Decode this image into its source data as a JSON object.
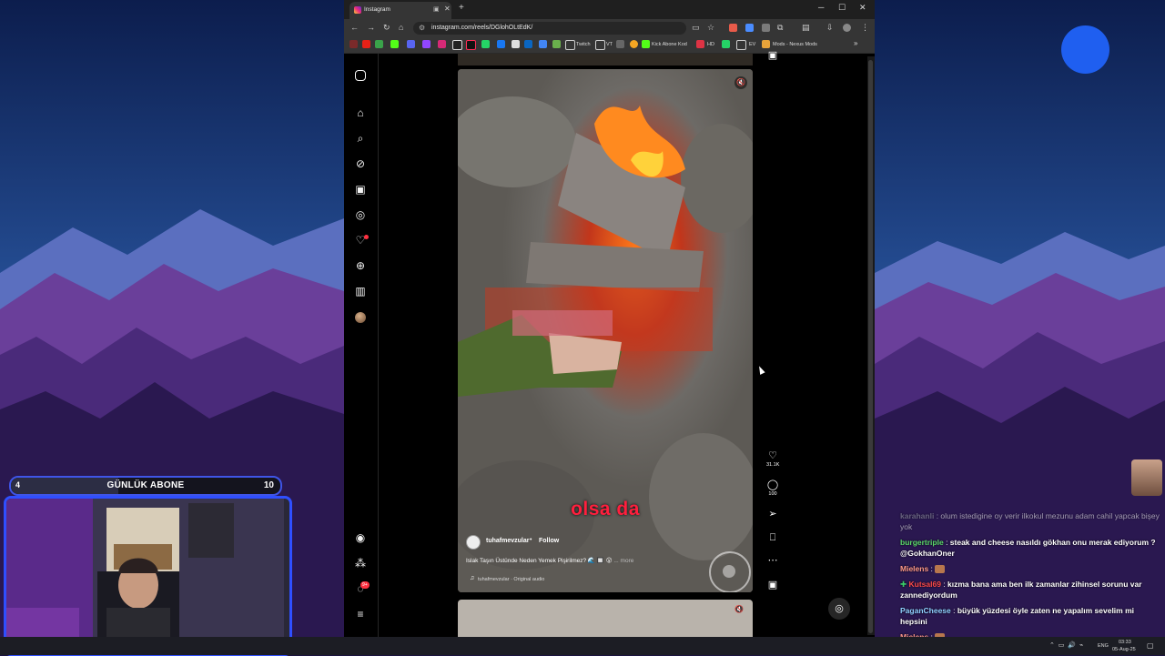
{
  "browser": {
    "tab_title": "Instagram",
    "new_tab": "+",
    "url": "instagram.com/reels/DGlohOLtEdK/",
    "bookmarks": [
      {
        "label": "Twitch"
      },
      {
        "label": "VT"
      },
      {
        "label": "Kick Abone Kod"
      },
      {
        "label": "HD"
      },
      {
        "label": "EV"
      },
      {
        "label": "Mods - Nexus Mods"
      }
    ]
  },
  "instagram": {
    "sidebar": [
      "instagram-logo-icon",
      "home-icon",
      "search-icon",
      "explore-icon",
      "reels-icon",
      "messenger-icon",
      "notifications-heart-icon",
      "create-plus-icon",
      "dashboard-icon",
      "profile-avatar",
      "threads-icon",
      "also-from-meta-icon",
      "notifications-icon",
      "menu-icon"
    ],
    "notifications_badge": "9+",
    "reel": {
      "caption_overlay": "olsa da",
      "author": "tuhafmevzular",
      "separator": "•",
      "follow": "Follow",
      "description": "Islak Taşın Üstünde Neden Yemek Pişirilmez? 🌊 🔲 😮",
      "more": "... more",
      "audio": "tuhafmevzular · Original audio",
      "likes": "31.1K",
      "comments": "100"
    }
  },
  "stream": {
    "sub_goal": {
      "current": "4",
      "label": "GÜNLÜK ABONE",
      "goal": "10",
      "progress": 0.4
    },
    "chat": [
      {
        "user": "karahanli",
        "text": "olum istedigine oy verir ilkokul mezunu adam cahil yapcak bişey yok",
        "color": "#9aa0a6",
        "faded": true
      },
      {
        "user": "burgertriple",
        "text": "steak and cheese nasıldı gökhan onu merak ediyorum ? @GokhanOner",
        "color": "#5bd96b"
      },
      {
        "user": "Mielens",
        "text": "",
        "color": "#ff9a8a",
        "emote": true
      },
      {
        "user": "Kutsal69",
        "text": "kızma bana ama ben ilk zamanlar zihinsel sorunu var zannediyordum",
        "color": "#ff4a4a",
        "badge": true
      },
      {
        "user": "PaganCheese",
        "text": "büyük yüzdesi öyle zaten ne yapalım sevelim mi hepsini",
        "color": "#8fd0ff"
      },
      {
        "user": "Mielens",
        "text": "",
        "color": "#ff9a8a",
        "emote": true
      }
    ]
  },
  "taskbar": {
    "lang": "ENG",
    "time": "03:33",
    "date": "05-Aug-25"
  }
}
